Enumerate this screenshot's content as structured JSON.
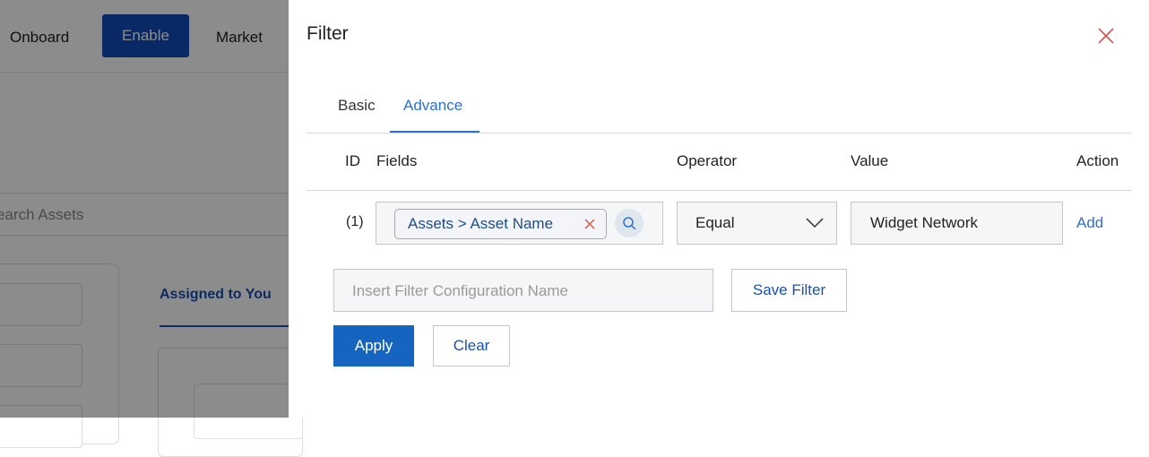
{
  "background": {
    "nav": {
      "onboard": "Onboard",
      "enable": "Enable",
      "market": "Market"
    },
    "search_text": "earch Assets",
    "tab_assigned": "Assigned to You"
  },
  "drawer": {
    "title": "Filter",
    "tabs": [
      {
        "label": "Basic",
        "active": false
      },
      {
        "label": "Advance",
        "active": true
      }
    ],
    "columns": {
      "id": "ID",
      "fields": "Fields",
      "operator": "Operator",
      "value": "Value",
      "action": "Action"
    },
    "rows": [
      {
        "id": "(1)",
        "field_chip": "Assets > Asset Name",
        "operator": "Equal",
        "value": "Widget Network",
        "action": "Add"
      }
    ],
    "config_placeholder": "Insert Filter Configuration Name",
    "save_filter_label": "Save Filter",
    "apply_label": "Apply",
    "clear_label": "Clear"
  },
  "icons": {
    "close": "close-icon",
    "chip_remove": "close-icon",
    "search": "search-icon",
    "chevron": "chevron-down-icon"
  },
  "colors": {
    "primary": "#1565c0",
    "link": "#2f6fd1",
    "close_red": "#d9534f",
    "nav_active": "#0f4bb8"
  }
}
